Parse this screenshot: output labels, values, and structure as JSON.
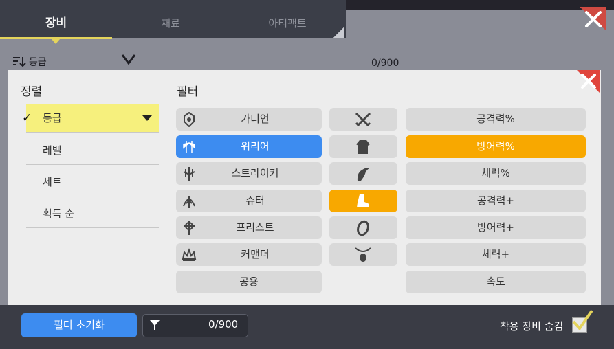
{
  "tabs": [
    {
      "label": "장비",
      "active": true
    },
    {
      "label": "재료",
      "active": false
    },
    {
      "label": "아티팩트",
      "active": false
    }
  ],
  "background": {
    "sort_label": "등급",
    "count": "0/900"
  },
  "sort_panel": {
    "title": "정렬",
    "items": [
      {
        "label": "등급",
        "selected": true
      },
      {
        "label": "레벨",
        "selected": false
      },
      {
        "label": "세트",
        "selected": false
      },
      {
        "label": "획득 순",
        "selected": false
      }
    ]
  },
  "filter_panel": {
    "title": "필터",
    "classes": [
      {
        "label": "가디언",
        "icon": "guardian-icon",
        "selected": false
      },
      {
        "label": "워리어",
        "icon": "warrior-icon",
        "selected": true
      },
      {
        "label": "스트라이커",
        "icon": "striker-icon",
        "selected": false
      },
      {
        "label": "슈터",
        "icon": "shooter-icon",
        "selected": false
      },
      {
        "label": "프리스트",
        "icon": "priest-icon",
        "selected": false
      },
      {
        "label": "커맨더",
        "icon": "commander-icon",
        "selected": false
      },
      {
        "label": "공용",
        "icon": "",
        "selected": false
      }
    ],
    "slots": [
      {
        "icon": "weapon-icon",
        "selected": false
      },
      {
        "icon": "armor-icon",
        "selected": false
      },
      {
        "icon": "gloves-icon",
        "selected": false
      },
      {
        "icon": "boots-icon",
        "selected": true
      },
      {
        "icon": "ring-icon",
        "selected": false
      },
      {
        "icon": "necklace-icon",
        "selected": false
      }
    ],
    "stats": [
      {
        "label": "공격력%",
        "selected": false
      },
      {
        "label": "방어력%",
        "selected": true
      },
      {
        "label": "체력%",
        "selected": false
      },
      {
        "label": "공격력+",
        "selected": false
      },
      {
        "label": "방어력+",
        "selected": false
      },
      {
        "label": "체력+",
        "selected": false
      },
      {
        "label": "속도",
        "selected": false
      }
    ]
  },
  "footer": {
    "reset_label": "필터 초기화",
    "count": "0/900",
    "hide_equipped_label": "착용 장비 숨김",
    "hide_equipped_checked": true
  },
  "colors": {
    "accent_blue": "#3d8cf0",
    "accent_orange": "#f8a800",
    "sort_highlight": "#f6f07d",
    "close_red": "#e0453c"
  }
}
